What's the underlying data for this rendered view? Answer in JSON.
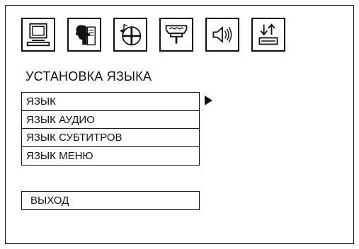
{
  "toolbar": {
    "icons": [
      {
        "name": "monitor-icon"
      },
      {
        "name": "language-speaker-icon"
      },
      {
        "name": "disc-music-icon"
      },
      {
        "name": "speaker-connector-icon"
      },
      {
        "name": "volume-icon"
      },
      {
        "name": "preferences-icon"
      }
    ],
    "selected_index": 1
  },
  "page": {
    "title": "УСТАНОВКА ЯЗЫКА"
  },
  "menu": {
    "items": [
      {
        "label": "ЯЗЫК"
      },
      {
        "label": "ЯЗЫК АУДИО"
      },
      {
        "label": "ЯЗЫК СУБТИТРОВ"
      },
      {
        "label": "ЯЗЫК МЕНЮ"
      }
    ],
    "highlighted_index": 0
  },
  "exit": {
    "label": "ВЫХОД"
  }
}
